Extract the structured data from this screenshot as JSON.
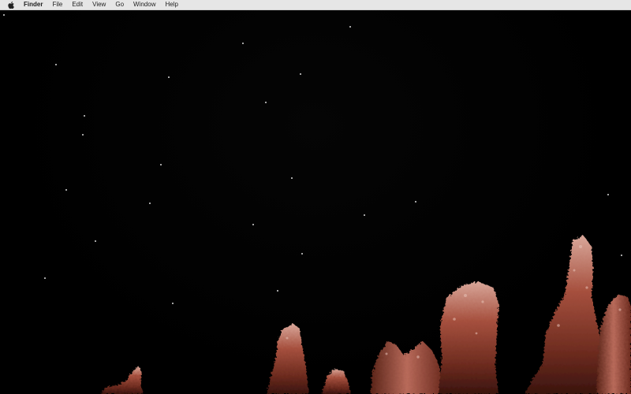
{
  "menubar": {
    "apple_icon": "apple-logo-icon",
    "app_name": "Finder",
    "items": [
      "File",
      "Edit",
      "View",
      "Go",
      "Window",
      "Help"
    ]
  },
  "wallpaper": {
    "description_colors": {
      "sky": "#000000",
      "stars": "#ffffff",
      "rock_dark": "#5a2418",
      "rock_mid": "#9b4a3a",
      "rock_light": "#d9a79a"
    }
  }
}
